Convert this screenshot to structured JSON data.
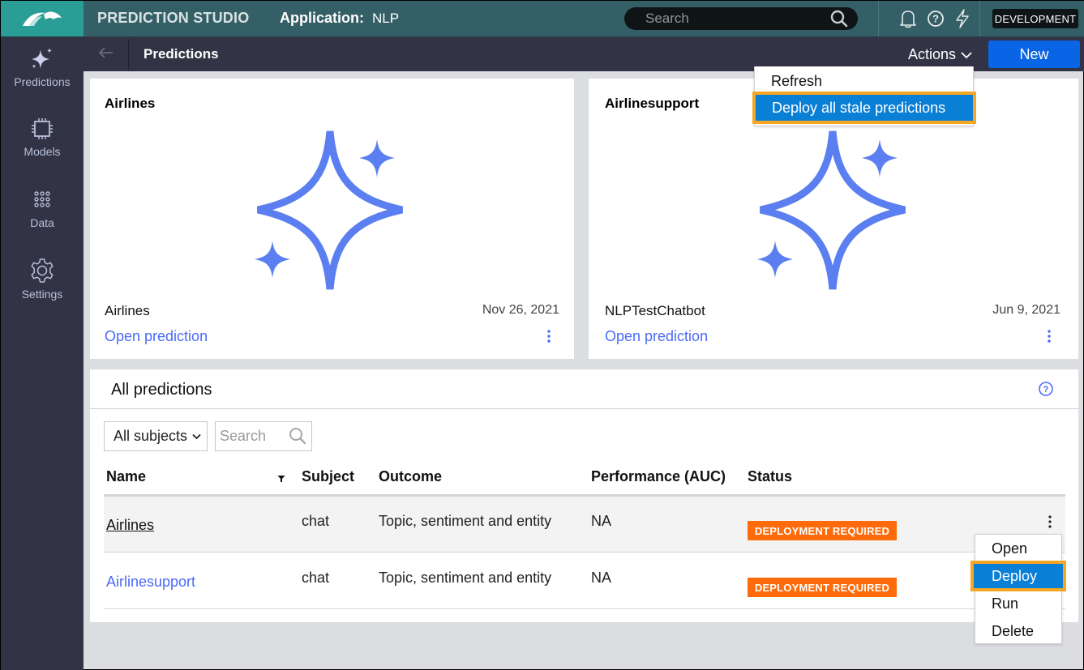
{
  "header": {
    "product": "PREDICTION STUDIO",
    "app_label": "Application:",
    "app_name": "NLP",
    "search_placeholder": "Search",
    "environment": "DEVELOPMENT",
    "icons": [
      "bell-icon",
      "help-icon",
      "lightning-icon"
    ]
  },
  "sidebar": {
    "items": [
      {
        "label": "Predictions",
        "icon": "sparkle-icon",
        "active": true
      },
      {
        "label": "Models",
        "icon": "chip-icon"
      },
      {
        "label": "Data",
        "icon": "dots-grid-icon"
      },
      {
        "label": "Settings",
        "icon": "gear-icon"
      }
    ]
  },
  "subheader": {
    "title": "Predictions",
    "actions_label": "Actions",
    "new_label": "New"
  },
  "actions_menu": {
    "items": [
      {
        "label": "Refresh"
      },
      {
        "label": "Deploy all stale predictions",
        "highlighted": true
      }
    ]
  },
  "cards": [
    {
      "title": "Airlines",
      "name": "Airlines",
      "date": "Nov 26, 2021",
      "link": "Open prediction"
    },
    {
      "title": "Airlinesupport",
      "name": "NLPTestChatbot",
      "date": "Jun 9, 2021",
      "link": "Open prediction"
    }
  ],
  "all_predictions": {
    "title": "All predictions",
    "subject_filter": "All subjects",
    "search_placeholder": "Search",
    "columns": [
      "Name",
      "Subject",
      "Outcome",
      "Performance (AUC)",
      "Status"
    ],
    "rows": [
      {
        "name": "Airlines",
        "subject": "chat",
        "outcome": "Topic, sentiment and entity",
        "performance": "NA",
        "status": "DEPLOYMENT REQUIRED"
      },
      {
        "name": "Airlinesupport",
        "subject": "chat",
        "outcome": "Topic, sentiment and entity",
        "performance": "NA",
        "status": "DEPLOYMENT REQUIRED"
      }
    ]
  },
  "row_menu": {
    "items": [
      {
        "label": "Open"
      },
      {
        "label": "Deploy",
        "highlighted": true
      },
      {
        "label": "Run"
      },
      {
        "label": "Delete"
      }
    ]
  },
  "colors": {
    "header_bg": "#355f66",
    "logo_bg": "#2a9d96",
    "sidebar_bg": "#323445",
    "primary_button": "#0a64e6",
    "link": "#4a6bf5",
    "status_badge": "#ff6b0a",
    "menu_highlight": "#0a7fd6",
    "highlight_outline": "#f5a623",
    "sparkle": "#5b7ff0"
  }
}
